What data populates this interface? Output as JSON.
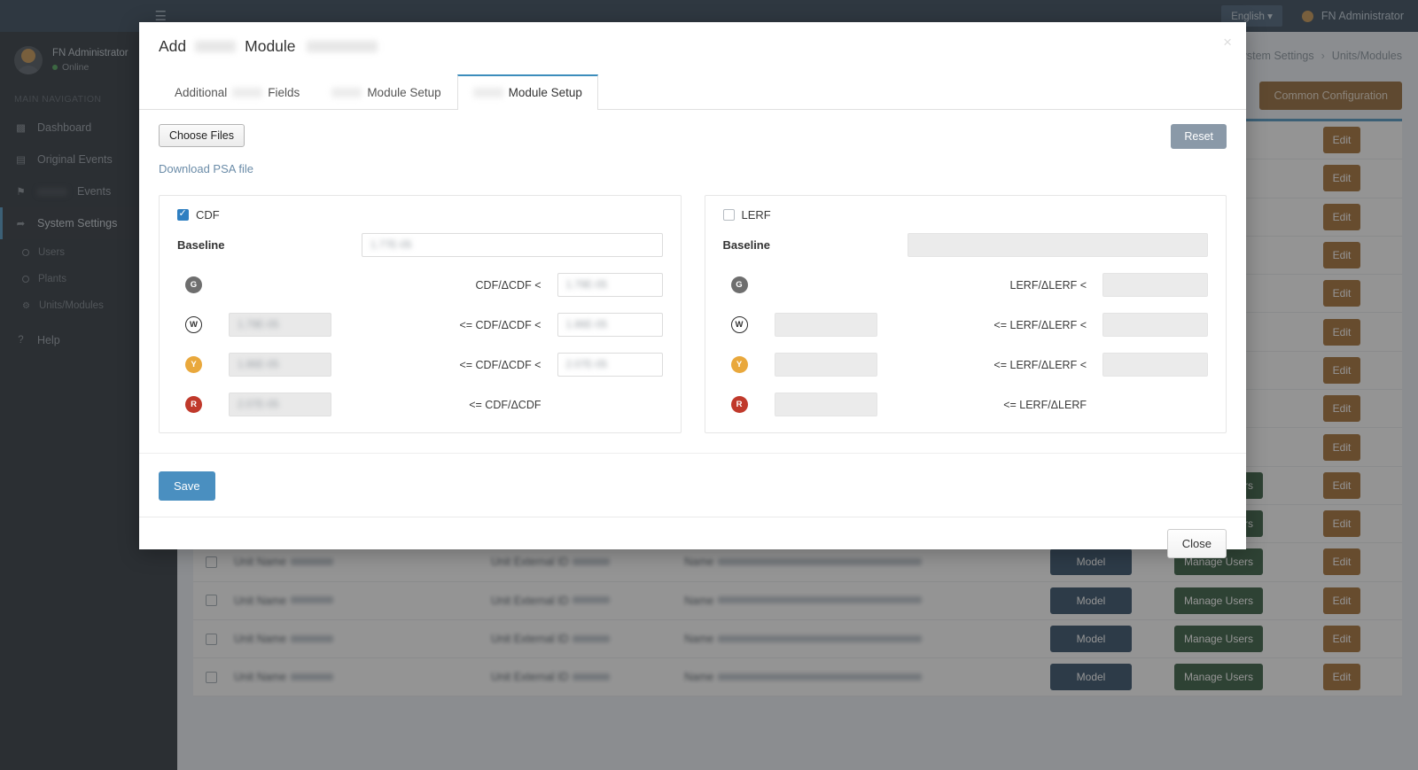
{
  "topbar": {
    "menu_icon": "hamburger-icon",
    "language": "English",
    "language_caret": "▾",
    "user": "FN Administrator"
  },
  "sidebar": {
    "user_name": "FN Administrator",
    "status": "Online",
    "section_title": "MAIN NAVIGATION",
    "items": [
      {
        "label": "Dashboard",
        "icon": "dashboard-icon",
        "redacted": false
      },
      {
        "label": "Original Events",
        "icon": "inbox-icon",
        "redacted": false
      },
      {
        "label": "Events",
        "icon": "flag-icon",
        "redacted": true
      },
      {
        "label": "System Settings",
        "icon": "arrow-icon",
        "redacted": false
      }
    ],
    "sub_items": [
      {
        "label": "Users",
        "icon": "circle-icon"
      },
      {
        "label": "Plants",
        "icon": "circle-icon"
      },
      {
        "label": "Units/Modules",
        "icon": "gear-icon"
      }
    ],
    "help": {
      "label": "Help",
      "icon": "question-icon"
    }
  },
  "breadcrumb": {
    "parent": "System Settings",
    "separator": "›",
    "current": "Units/Modules"
  },
  "page_actions": {
    "common_configuration": "Common Configuration"
  },
  "table": {
    "columns": [
      "",
      "Unit Name",
      "Unit External ID",
      "Name",
      "",
      "",
      ""
    ],
    "cell_labels": {
      "unit_name": "Unit Name",
      "unit_external_id": "Unit External ID",
      "name": "Name"
    },
    "buttons": {
      "model": "Model",
      "manage_users": "Manage Users",
      "edit": "Edit"
    },
    "row_count_visible": 15,
    "rows_with_full_buttons": 6
  },
  "modal": {
    "title_prefix": "Add",
    "title_suffix": "Module",
    "close_icon": "×",
    "tabs": [
      {
        "label_pre": "Additional",
        "label_post": "Fields",
        "active": false
      },
      {
        "label_pre": "",
        "label_post": "Module Setup",
        "active": false
      },
      {
        "label_pre": "",
        "label_post": "Module Setup",
        "active": true
      }
    ],
    "choose_files": "Choose Files",
    "reset": "Reset",
    "download_link": "Download PSA file",
    "save": "Save",
    "close": "Close",
    "cdf": {
      "checkbox_label": "CDF",
      "checked": true,
      "baseline_label": "Baseline",
      "baseline_value": "1.77E-05",
      "rows": [
        {
          "badge": "G",
          "badge_color": "#6e6e6e",
          "left_value": "",
          "operator": "CDF/ΔCDF <",
          "right_value": "1.79E-05"
        },
        {
          "badge": "W",
          "badge_color": "#ffffff",
          "left_value": "1.79E-05",
          "operator": "<= CDF/ΔCDF <",
          "right_value": "1.86E-05"
        },
        {
          "badge": "Y",
          "badge_color": "#e9a83c",
          "left_value": "1.86E-05",
          "operator": "<= CDF/ΔCDF <",
          "right_value": "2.07E-05"
        },
        {
          "badge": "R",
          "badge_color": "#c0392b",
          "left_value": "2.07E-05",
          "operator": "<= CDF/ΔCDF",
          "right_value": ""
        }
      ]
    },
    "lerf": {
      "checkbox_label": "LERF",
      "checked": false,
      "baseline_label": "Baseline",
      "baseline_value": "",
      "rows": [
        {
          "badge": "G",
          "badge_color": "#6e6e6e",
          "left_value": "",
          "operator": "LERF/ΔLERF <",
          "right_value": ""
        },
        {
          "badge": "W",
          "badge_color": "#ffffff",
          "left_value": "",
          "operator": "<= LERF/ΔLERF <",
          "right_value": ""
        },
        {
          "badge": "Y",
          "badge_color": "#e9a83c",
          "left_value": "",
          "operator": "<= LERF/ΔLERF <",
          "right_value": ""
        },
        {
          "badge": "R",
          "badge_color": "#c0392b",
          "left_value": "",
          "operator": "<= LERF/ΔLERF",
          "right_value": ""
        }
      ]
    }
  },
  "colors": {
    "accent_blue": "#3c8dbc",
    "sidebar_dark": "#171f28",
    "topbar_dark": "#1f3347",
    "brown": "#9c5f1d",
    "green": "#1e4a2a",
    "navy": "#1b3a57"
  }
}
